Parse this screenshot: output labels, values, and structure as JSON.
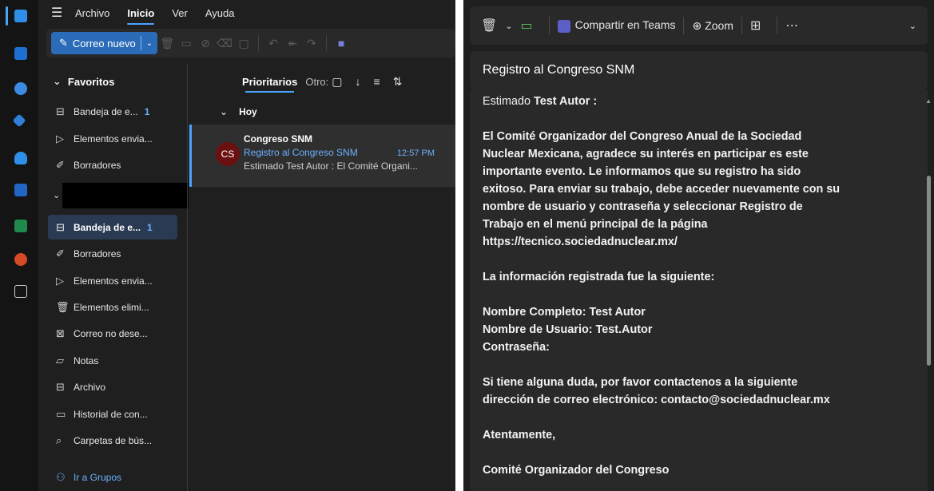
{
  "menu": {
    "items": [
      "Archivo",
      "Inicio",
      "Ver",
      "Ayuda"
    ],
    "active_index": 1
  },
  "ribbon": {
    "new_mail_label": "Correo nuevo"
  },
  "favorites": {
    "header": "Favoritos",
    "items": [
      {
        "label": "Bandeja de e...",
        "count": "1",
        "icon": "inbox-icon"
      },
      {
        "label": "Elementos envia...",
        "count": "",
        "icon": "send-icon"
      },
      {
        "label": "Borradores",
        "count": "",
        "icon": "draft-icon"
      }
    ]
  },
  "account": {
    "items": [
      {
        "label": "Bandeja de e...",
        "count": "1",
        "icon": "inbox-icon",
        "selected": true
      },
      {
        "label": "Borradores",
        "count": "",
        "icon": "draft-icon"
      },
      {
        "label": "Elementos envia...",
        "count": "",
        "icon": "send-icon"
      },
      {
        "label": "Elementos elimi...",
        "count": "",
        "icon": "trash-icon"
      },
      {
        "label": "Correo no dese...",
        "count": "",
        "icon": "junk-icon"
      },
      {
        "label": "Notas",
        "count": "",
        "icon": "note-icon"
      },
      {
        "label": "Archivo",
        "count": "",
        "icon": "archive-icon"
      },
      {
        "label": "Historial de con...",
        "count": "",
        "icon": "folder-icon"
      },
      {
        "label": "Carpetas de bús...",
        "count": "",
        "icon": "search-folder-icon"
      }
    ],
    "groups_link": "Ir a Grupos"
  },
  "list": {
    "tab_focused": "Prioritarios",
    "tab_other": "Otro:",
    "group": "Hoy",
    "message": {
      "initials": "CS",
      "sender": "Congreso SNM",
      "subject": "Registro al Congreso SNM",
      "time": "12:57 PM",
      "preview": "Estimado Test Autor : El Comité Organi..."
    }
  },
  "reading": {
    "toolbar": {
      "teams": "Compartir en Teams",
      "zoom": "Zoom"
    },
    "subject": "Registro al Congreso SNM",
    "salutation_prefix": "Estimado ",
    "salutation_name": "Test Autor :",
    "body": [
      "El Comité Organizador del Congreso Anual de la Sociedad",
      "Nuclear Mexicana, agradece su interés en participar es este",
      "importante evento. Le informamos que su registro ha sido",
      "exitoso. Para enviar su trabajo, debe acceder nuevamente con su",
      "nombre de usuario y contraseña y seleccionar Registro de",
      "Trabajo en el menú principal de la página",
      "https://tecnico.sociedadnuclear.mx/",
      "",
      "La información registrada fue la siguiente:",
      "",
      "Nombre Completo: Test Autor",
      "Nombre de Usuario: Test.Autor",
      "Contraseña:",
      "",
      "Si tiene alguna duda, por favor contactenos a la siguiente",
      "dirección de correo electrónico: contacto@sociedadnuclear.mx",
      "",
      "Atentamente,",
      "",
      "Comité Organizador del Congreso"
    ]
  },
  "colors": {
    "accent": "#4aa3ff",
    "background": "#1f1f1f",
    "avatar": "#6b1010",
    "selected": "#2a3a52"
  }
}
